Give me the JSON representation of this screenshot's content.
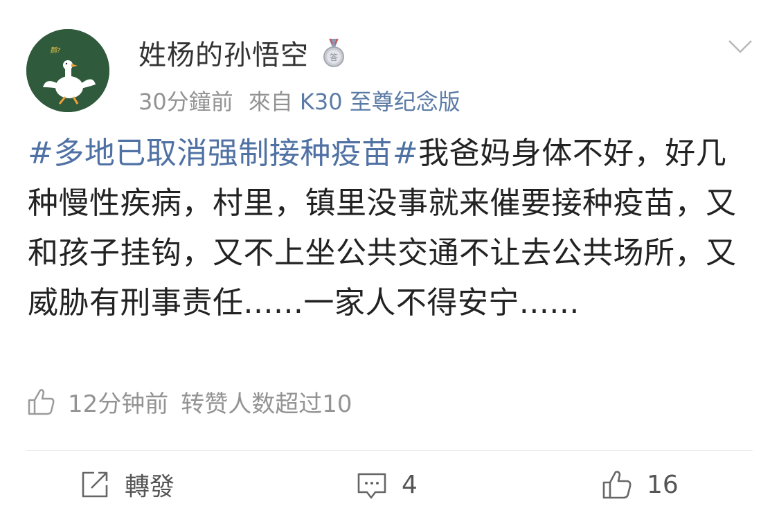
{
  "post": {
    "username": "姓杨的孙悟空",
    "badge_icon": "medal-icon",
    "time": "30分鐘前",
    "source_prefix": "來自",
    "device": "K30 至尊纪念版",
    "topic": "#多地已取消强制接种疫苗#",
    "body": "我爸妈身体不好，好几种慢性疾病，村里，镇里没事就来催要接种疫苗，又和孩子挂钩，又不上坐公共交通不让去公共场所，又威胁有刑事责任......一家人不得安宁......",
    "avatar_text": "鹅?"
  },
  "liked_info": {
    "time": "12分钟前",
    "text": "转赞人数超过10"
  },
  "actions": {
    "repost_label": "轉發",
    "comment_count": "4",
    "like_count": "16"
  },
  "colors": {
    "topic_link": "#4f71a3",
    "device_link": "#5b7ba6",
    "muted_text": "#939393",
    "avatar_bg": "#2f5a3c"
  }
}
